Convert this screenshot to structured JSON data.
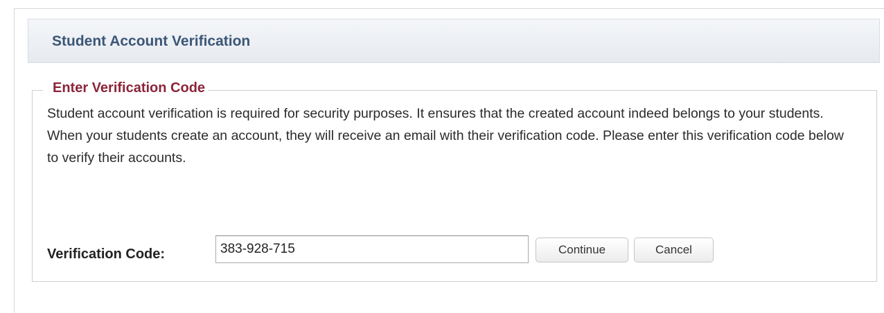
{
  "header": {
    "title": "Student Account Verification"
  },
  "section": {
    "legend": "Enter Verification Code",
    "description": "Student account verification is required for security purposes. It ensures that the created account indeed belongs to your students. When your students create an account, they will receive an email with their verification code. Please enter this verification code below to verify their accounts."
  },
  "form": {
    "code_label": "Verification Code:",
    "code_value": "383-928-715",
    "continue_label": "Continue",
    "cancel_label": "Cancel"
  },
  "colors": {
    "header_title": "#3c5677",
    "legend": "#8b2439",
    "text": "#2b2b2b"
  }
}
